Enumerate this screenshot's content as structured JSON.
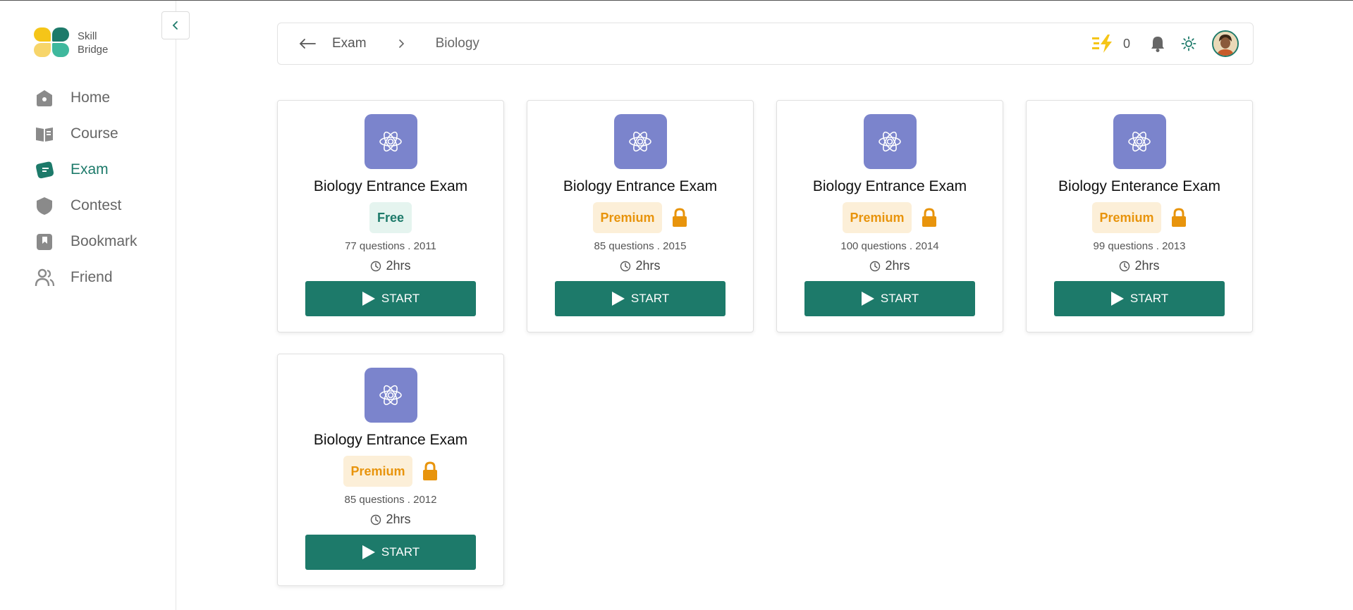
{
  "brand": {
    "line1": "Skill",
    "line2": "Bridge"
  },
  "nav": [
    {
      "label": "Home",
      "icon": "home-icon",
      "active": false
    },
    {
      "label": "Course",
      "icon": "book-icon",
      "active": false
    },
    {
      "label": "Exam",
      "icon": "exam-icon",
      "active": true
    },
    {
      "label": "Contest",
      "icon": "shield-icon",
      "active": false
    },
    {
      "label": "Bookmark",
      "icon": "bookmark-icon",
      "active": false
    },
    {
      "label": "Friend",
      "icon": "friends-icon",
      "active": false
    }
  ],
  "header": {
    "crumb_parent": "Exam",
    "crumb_current": "Biology",
    "streak_count": "0"
  },
  "cards": [
    {
      "title": "Biology Entrance Exam",
      "badge": "Free",
      "badge_type": "free",
      "locked": false,
      "meta": "77 questions . 2011",
      "duration": "2hrs",
      "button": "START"
    },
    {
      "title": "Biology Entrance Exam",
      "badge": "Premium",
      "badge_type": "premium",
      "locked": true,
      "meta": "85 questions . 2015",
      "duration": "2hrs",
      "button": "START"
    },
    {
      "title": "Biology Entrance Exam",
      "badge": "Premium",
      "badge_type": "premium",
      "locked": true,
      "meta": "100 questions . 2014",
      "duration": "2hrs",
      "button": "START"
    },
    {
      "title": "Biology Enterance Exam",
      "badge": "Premium",
      "badge_type": "premium",
      "locked": true,
      "meta": "99 questions . 2013",
      "duration": "2hrs",
      "button": "START"
    },
    {
      "title": "Biology Entrance Exam",
      "badge": "Premium",
      "badge_type": "premium",
      "locked": true,
      "meta": "85 questions . 2012",
      "duration": "2hrs",
      "button": "START"
    }
  ],
  "colors": {
    "accent": "#1d7a6a",
    "premium": "#e8940c",
    "icon_bg": "#7b84cc",
    "streak": "#f5c518"
  }
}
